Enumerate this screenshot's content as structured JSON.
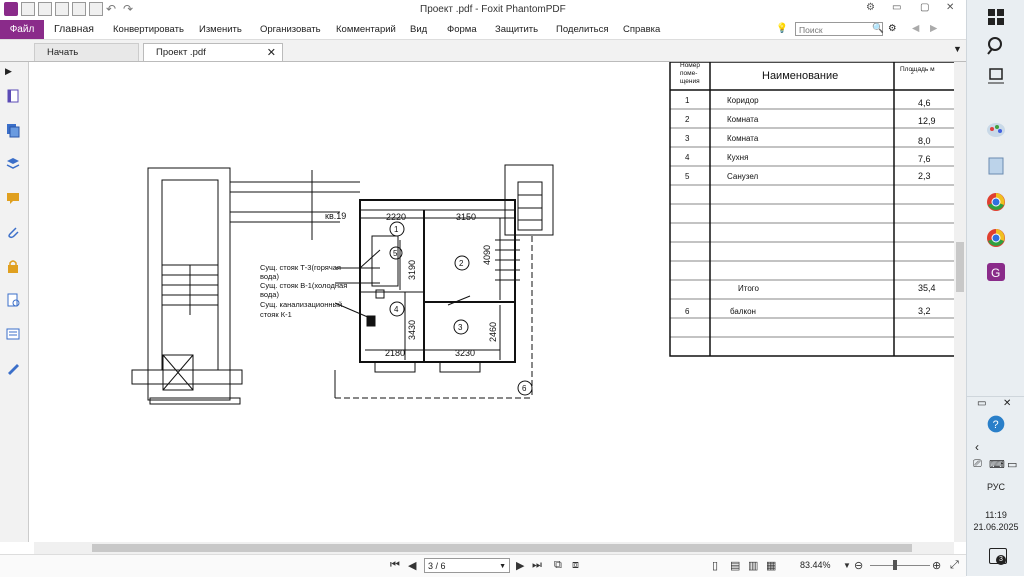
{
  "window": {
    "title": "Проект .pdf - Foxit PhantomPDF"
  },
  "menu": {
    "file": "Файл",
    "items": [
      "Главная",
      "Конвертировать",
      "Изменить",
      "Организовать",
      "Комментарий",
      "Вид",
      "Форма",
      "Защитить",
      "Поделиться",
      "Справка"
    ],
    "search_placeholder": "Поиск"
  },
  "tabs": [
    {
      "label": "Начать"
    },
    {
      "label": "Проект .pdf"
    }
  ],
  "plan": {
    "apartment_label": "кв.19",
    "dims": {
      "d2220": "2220",
      "d3150": "3150",
      "d3190": "3190",
      "d4090": "4090",
      "d3430": "3430",
      "d2460": "2460",
      "d2180": "2180",
      "d3230": "3230"
    },
    "room_numbers": [
      "1",
      "2",
      "3",
      "4",
      "5",
      "6"
    ],
    "notes": [
      "Сущ. стояк Т-3(горячая",
      "вода)",
      "Сущ. стояк В-1(холодная",
      "вода)",
      "Сущ. канализационный",
      "стояк К-1"
    ]
  },
  "table": {
    "header_num": [
      "Номер",
      "поме-",
      "щения"
    ],
    "header_name": "Наименование",
    "header_area": "Площадь м",
    "header_area_sup": "2",
    "rows": [
      {
        "num": "1",
        "name": "Коридор",
        "area": "4,6"
      },
      {
        "num": "2",
        "name": "Комната",
        "area": "12,9"
      },
      {
        "num": "3",
        "name": "Комната",
        "area": "8,0"
      },
      {
        "num": "4",
        "name": "Кухня",
        "area": "7,6"
      },
      {
        "num": "5",
        "name": "Санузел",
        "area": "2,3"
      }
    ],
    "total_label": "Итого",
    "total_area": "35,4",
    "balcony": {
      "num": "6",
      "name": "балкон",
      "area": "3,2"
    }
  },
  "status": {
    "page": "3 / 6",
    "zoom": "83.44%"
  },
  "taskbar": {
    "lang": "РУС",
    "time": "11:19",
    "date": "21.06.2025",
    "notifications": "3"
  }
}
